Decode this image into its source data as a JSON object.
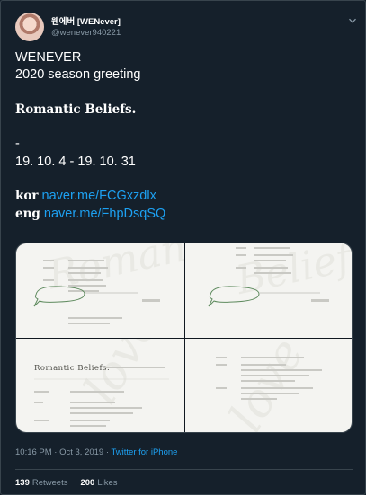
{
  "author": {
    "display_name": "웬에버 [WENever]",
    "handle": "@wenever940221"
  },
  "tweet": {
    "lines": [
      "WENEVER",
      "2020 season greeting",
      "",
      "Romantic Beliefs.",
      "",
      "-",
      "19. 10. 4 - 19. 10. 31",
      "",
      "kor",
      "eng"
    ],
    "kor_link": "naver.me/FCGxzdlx",
    "eng_link": "naver.me/FhpDsqSQ"
  },
  "media": {
    "card_title": "Romantic Beliefs."
  },
  "meta": {
    "timestamp": "10:16 PM · Oct 3, 2019",
    "separator": " · ",
    "source": "Twitter for iPhone"
  },
  "stats": {
    "retweets_count": "139",
    "retweets_label": "Retweets",
    "likes_count": "200",
    "likes_label": "Likes"
  },
  "colors": {
    "background": "#15202b",
    "link": "#1da1f2",
    "secondary_text": "#8899a6",
    "border": "#38444d"
  }
}
